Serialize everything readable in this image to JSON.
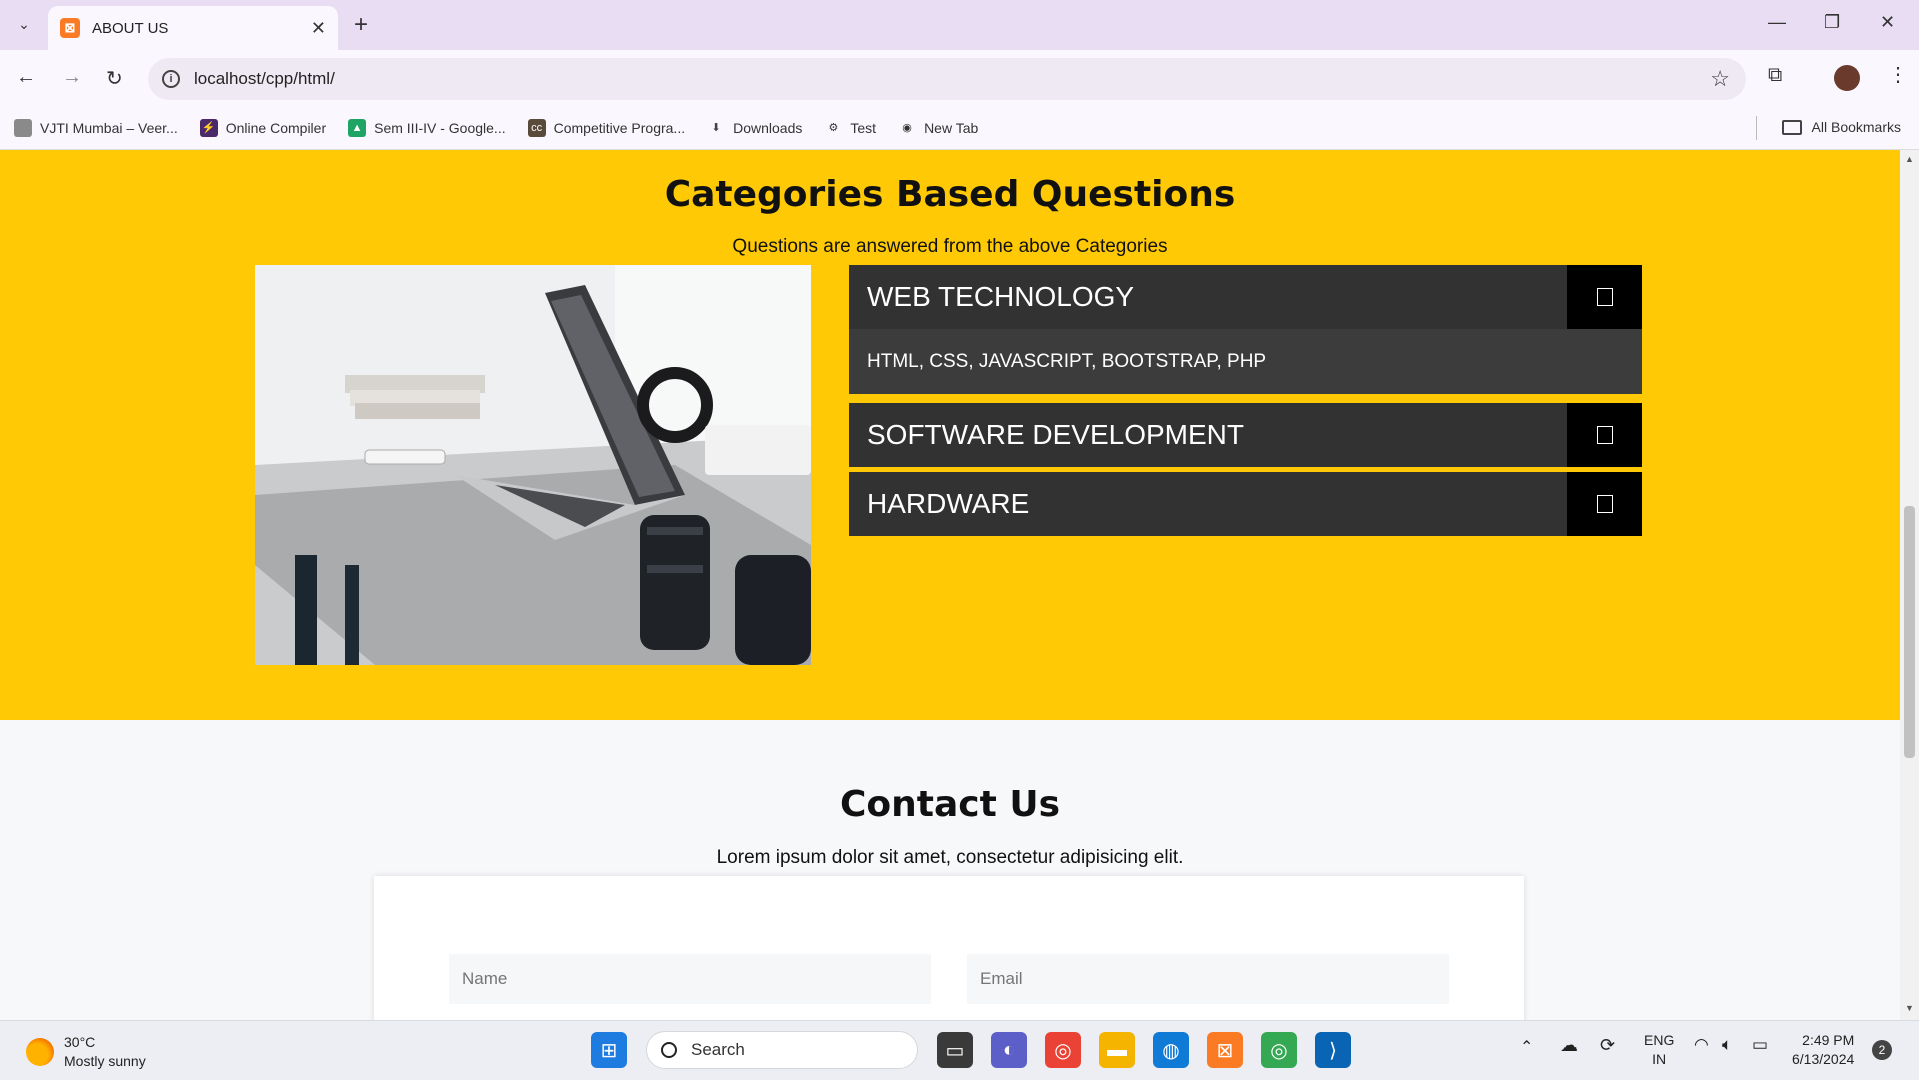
{
  "browser": {
    "tab_title": "ABOUT US",
    "url": "localhost/cpp/html/",
    "bookmarks": [
      {
        "label": "VJTI Mumbai – Veer...",
        "color": "#8a8a8a"
      },
      {
        "label": "Online Compiler",
        "color": "#4a2a6a"
      },
      {
        "label": "Sem III-IV - Google...",
        "color": "#1fa463"
      },
      {
        "label": "Competitive Progra...",
        "color": "#5a4a3a"
      },
      {
        "label": "Downloads",
        "color": "#444444"
      },
      {
        "label": "Test",
        "color": "#333333"
      },
      {
        "label": "New Tab",
        "color": "#333333"
      }
    ],
    "all_bookmarks": "All Bookmarks"
  },
  "categories": {
    "title": "Categories Based Questions",
    "subtitle": "Questions are answered from the above Categories",
    "items": [
      {
        "heading": "WEB TECHNOLOGY",
        "body": "HTML, CSS, JAVASCRIPT, BOOTSTRAP, PHP",
        "expanded": true
      },
      {
        "heading": "SOFTWARE DEVELOPMENT",
        "expanded": false
      },
      {
        "heading": "HARDWARE",
        "expanded": false
      }
    ],
    "background_color": "#ffc905",
    "accordion_color": "#323232"
  },
  "contact": {
    "title": "Contact Us",
    "subtitle": "Lorem ipsum dolor sit amet, consectetur adipisicing elit.",
    "name_placeholder": "Name",
    "email_placeholder": "Email"
  },
  "taskbar": {
    "temperature": "30°C",
    "weather": "Mostly sunny",
    "search_label": "Search",
    "lang": "ENG",
    "region": "IN",
    "time": "2:49 PM",
    "date": "6/13/2024",
    "notification_count": "2"
  }
}
